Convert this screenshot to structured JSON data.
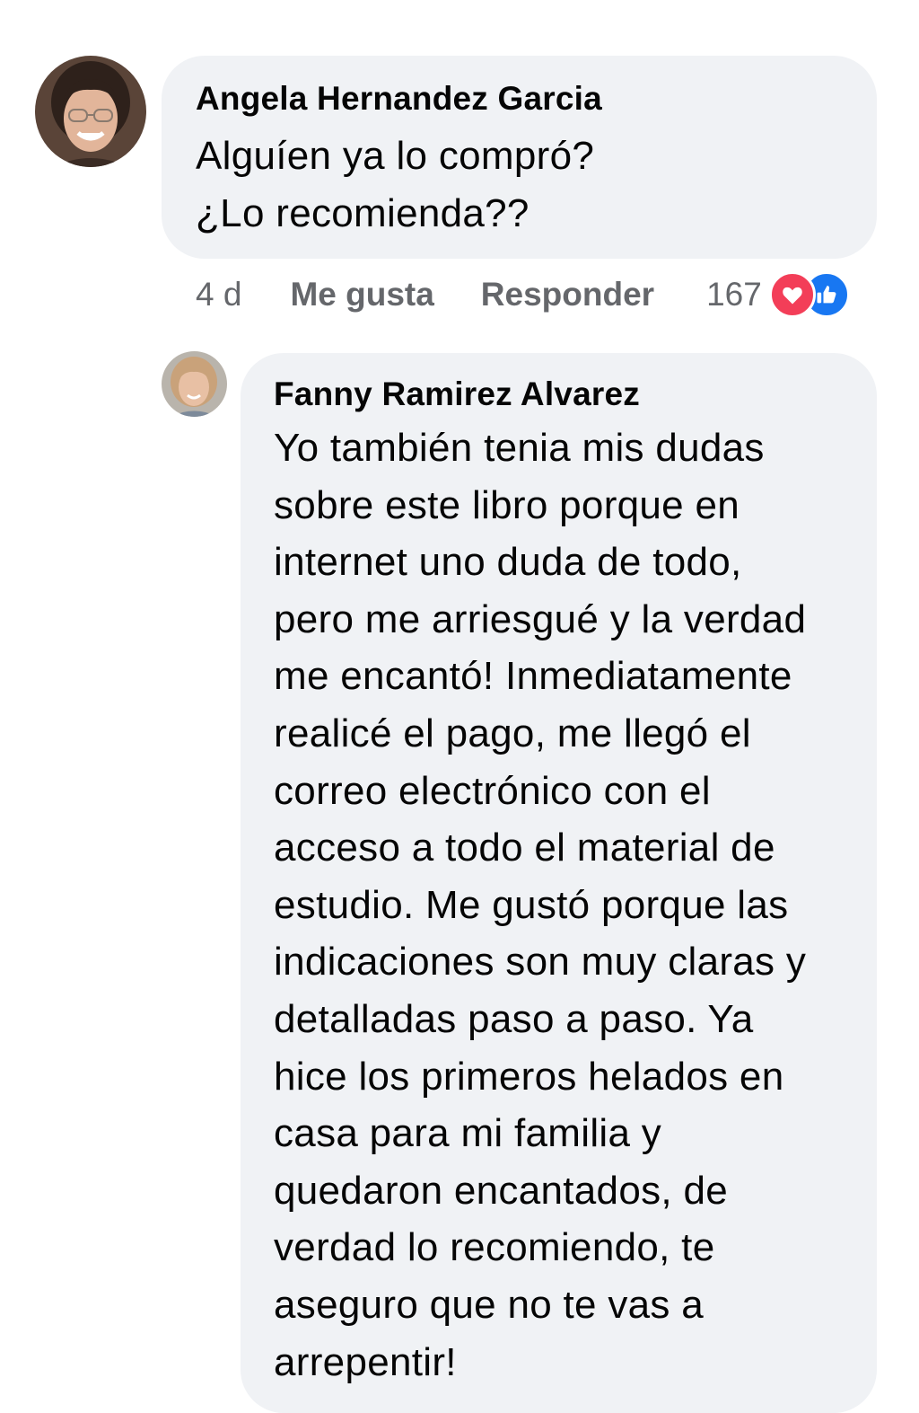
{
  "comment": {
    "author": "Angela Hernandez Garcia",
    "text": "Alguíen ya lo compró?\n¿Lo recomienda??",
    "time": "4 d",
    "like_label": "Me gusta",
    "reply_label": "Responder",
    "reaction_count": "167",
    "reactions": [
      "love-icon",
      "like-icon"
    ],
    "colors": {
      "love": "#f33e58",
      "like": "#1877f2",
      "bubble": "#f0f2f5",
      "meta": "#65676b"
    }
  },
  "reply": {
    "author": "Fanny Ramirez Alvarez",
    "text": "Yo también tenia mis dudas\nsobre este libro porque en\ninternet uno duda de todo,\npero me arriesgué y la verdad\nme encantó! Inmediatamente\nrealicé el pago, me llegó el\ncorreo electrónico con el\nacceso a todo el material de\nestudio. Me gustó porque las\nindicaciones son muy claras y\ndetalladas paso a paso. Ya\nhice los primeros helados en\ncasa para mi familia y\nquedaron encantados, de\nverdad lo recomiendo, te\naseguro que no te vas a\narrepentir!"
  }
}
